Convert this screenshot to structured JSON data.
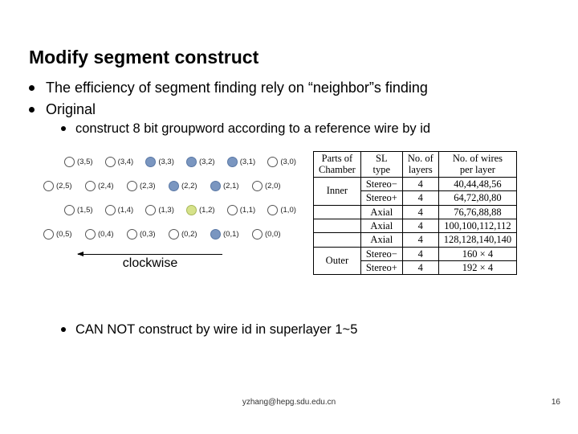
{
  "title": "Modify segment construct",
  "bullets": [
    "The efficiency of segment finding rely on “neighbor”s finding",
    "Original"
  ],
  "sub1": "construct 8 bit groupword according to a reference wire by id",
  "sub2": "CAN NOT construct by wire id in superlayer 1~5",
  "clockwise_label": "clockwise",
  "grid": {
    "rows": [
      {
        "offset": true,
        "cells": [
          {
            "c": "(3,5)",
            "f": 0
          },
          {
            "c": "(3,4)",
            "f": 0
          },
          {
            "c": "(3,3)",
            "f": 1
          },
          {
            "c": "(3,2)",
            "f": 1
          },
          {
            "c": "(3,1)",
            "f": 1
          },
          {
            "c": "(3,0)",
            "f": 0
          }
        ]
      },
      {
        "offset": false,
        "cells": [
          {
            "c": "(2,5)",
            "f": 0
          },
          {
            "c": "(2,4)",
            "f": 0
          },
          {
            "c": "(2,3)",
            "f": 0
          },
          {
            "c": "(2,2)",
            "f": 1
          },
          {
            "c": "(2,1)",
            "f": 1
          },
          {
            "c": "(2,0)",
            "f": 0
          }
        ]
      },
      {
        "offset": true,
        "cells": [
          {
            "c": "(1,5)",
            "f": 0
          },
          {
            "c": "(1,4)",
            "f": 0
          },
          {
            "c": "(1,3)",
            "f": 0
          },
          {
            "c": "(1,2)",
            "f": 2
          },
          {
            "c": "(1,1)",
            "f": 0
          },
          {
            "c": "(1,0)",
            "f": 0
          }
        ]
      },
      {
        "offset": false,
        "cells": [
          {
            "c": "(0,5)",
            "f": 0
          },
          {
            "c": "(0,4)",
            "f": 0
          },
          {
            "c": "(0,3)",
            "f": 0
          },
          {
            "c": "(0,2)",
            "f": 0
          },
          {
            "c": "(0,1)",
            "f": 1
          },
          {
            "c": "(0,0)",
            "f": 0
          }
        ]
      }
    ]
  },
  "table": {
    "headers": [
      "Parts of\nChamber",
      "SL\ntype",
      "No. of\nlayers",
      "No. of wires\nper layer"
    ],
    "rows": [
      {
        "part": "Inner",
        "span": 2,
        "type": "Stereo−",
        "layers": "4",
        "wires": "40,44,48,56"
      },
      {
        "part": null,
        "type": "Stereo+",
        "layers": "4",
        "wires": "64,72,80,80"
      },
      {
        "part": "",
        "span": 1,
        "type": "Axial",
        "layers": "4",
        "wires": "76,76,88,88"
      },
      {
        "part": "",
        "span": 1,
        "type": "Axial",
        "layers": "4",
        "wires": "100,100,112,112"
      },
      {
        "part": "",
        "span": 1,
        "type": "Axial",
        "layers": "4",
        "wires": "128,128,140,140"
      },
      {
        "part": "Outer",
        "span": 2,
        "type": "Stereo−",
        "layers": "4",
        "wires": "160 × 4"
      },
      {
        "part": null,
        "type": "Stereo+",
        "layers": "4",
        "wires": "192 × 4"
      }
    ]
  },
  "footer": {
    "email": "yzhang@hepg.sdu.edu.cn",
    "page": "16"
  }
}
